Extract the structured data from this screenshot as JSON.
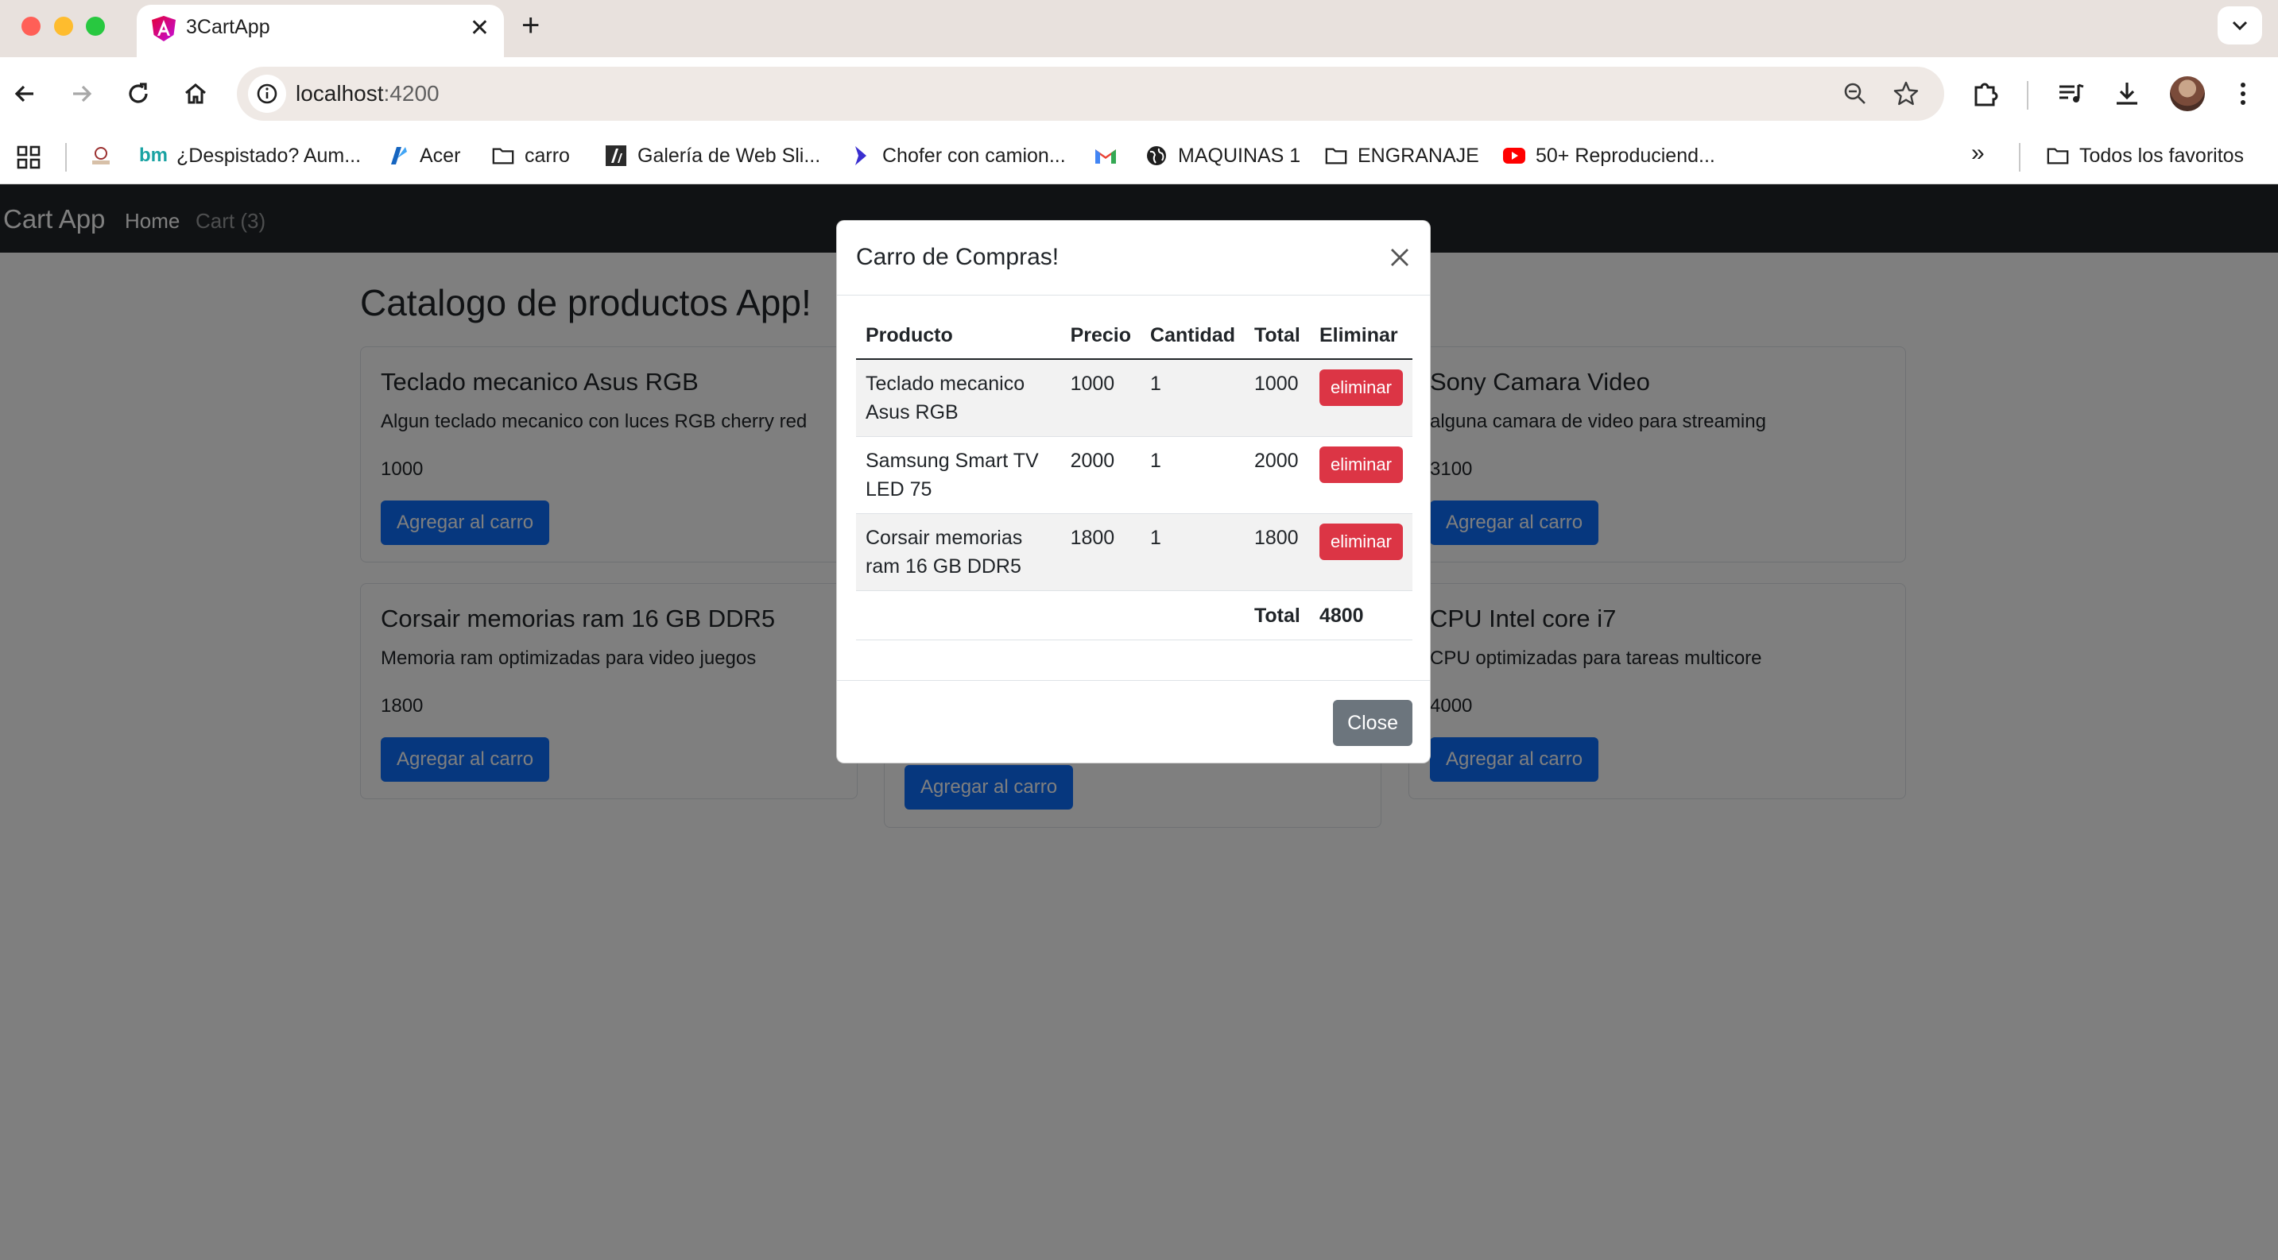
{
  "browser": {
    "tab_title": "3CartApp",
    "url_host": "localhost",
    "url_port": ":4200",
    "bookmarks": [
      {
        "label": "¿Despistado? Aum...",
        "icon": "bm-logo-icon"
      },
      {
        "label": "Acer",
        "icon": "acer-logo-icon"
      },
      {
        "label": "carro",
        "icon": "folder-icon"
      },
      {
        "label": "Galería de Web Sli...",
        "icon": "web-slice-icon"
      },
      {
        "label": "Chofer con camion...",
        "icon": "arrow-logo-icon"
      },
      {
        "label": "MAQUINAS 1",
        "icon": "globe-icon"
      },
      {
        "label": "ENGRANAJE",
        "icon": "folder-icon"
      },
      {
        "label": "50+ Reproduciend...",
        "icon": "youtube-icon"
      }
    ],
    "all_bookmarks": "Todos los favoritos"
  },
  "app": {
    "brand": "Cart App",
    "nav_home": "Home",
    "nav_cart": "Cart (3)",
    "catalog_title": "Catalogo de productos App!"
  },
  "products": [
    {
      "name": "Teclado mecanico Asus RGB",
      "description": "Algun teclado mecanico con luces RGB cherry red",
      "price": "1000",
      "button": "Agregar al carro"
    },
    {
      "name": "Sony Camara Video",
      "description": "alguna camara de video para streaming",
      "price": "3100",
      "button": "Agregar al carro"
    },
    {
      "name": "Corsair memorias ram 16 GB DDR5",
      "description": "Memoria ram optimizadas para video juegos",
      "price": "1800",
      "button": "Agregar al carro"
    },
    {
      "name": "CPU Intel core i7",
      "description": "CPU optimizadas para tareas multicore",
      "price": "4000",
      "button": "Agregar al carro"
    },
    {
      "name": "",
      "description": "",
      "price": "",
      "button": "Agregar al carro"
    }
  ],
  "modal": {
    "title": "Carro de Compras!",
    "columns": [
      "Producto",
      "Precio",
      "Cantidad",
      "Total",
      "Eliminar"
    ],
    "items": [
      {
        "producto": "Teclado mecanico Asus RGB",
        "precio": "1000",
        "cantidad": "1",
        "total": "1000",
        "action": "eliminar"
      },
      {
        "producto": "Samsung Smart TV LED 75",
        "precio": "2000",
        "cantidad": "1",
        "total": "2000",
        "action": "eliminar"
      },
      {
        "producto": "Corsair memorias ram 16 GB DDR5",
        "precio": "1800",
        "cantidad": "1",
        "total": "1800",
        "action": "eliminar"
      }
    ],
    "total_label": "Total",
    "total_value": "4800",
    "close_label": "Close"
  },
  "colors": {
    "primary": "#0d6efd",
    "danger": "#dc3545",
    "secondary": "#6c757d",
    "navbar": "#212529"
  }
}
